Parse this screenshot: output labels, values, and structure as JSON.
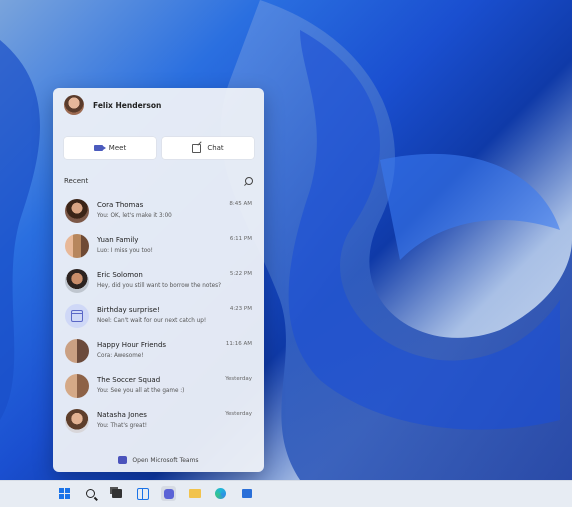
{
  "user": {
    "name": "Felix Henderson"
  },
  "actions": {
    "meet_label": "Meet",
    "chat_label": "Chat"
  },
  "recent": {
    "label": "Recent",
    "items": [
      {
        "name": "Cora Thomas",
        "message": "You: OK, let's make it 3:00",
        "time": "8:45 AM"
      },
      {
        "name": "Yuan Family",
        "message": "Luo: I miss you too!",
        "time": "6:11 PM"
      },
      {
        "name": "Eric Solomon",
        "message": "Hey, did you still want to borrow the notes?",
        "time": "5:22 PM"
      },
      {
        "name": "Birthday surprise!",
        "message": "Noel: Can't wait for our next catch up!",
        "time": "4:23 PM"
      },
      {
        "name": "Happy Hour Friends",
        "message": "Cora: Awesome!",
        "time": "11:16 AM"
      },
      {
        "name": "The Soccer Squad",
        "message": "You: See you all at the game :)",
        "time": "Yesterday"
      },
      {
        "name": "Natasha Jones",
        "message": "You: That's great!",
        "time": "Yesterday"
      }
    ]
  },
  "footer": {
    "open_teams_label": "Open Microsoft Teams"
  },
  "taskbar": {
    "icons": [
      "windows-start-icon",
      "search-icon",
      "task-view-icon",
      "widgets-icon",
      "teams-chat-icon",
      "file-explorer-icon",
      "edge-browser-icon",
      "store-icon"
    ]
  },
  "colors": {
    "accent": "#4b53bc",
    "panel_bg": "#eef1f7"
  }
}
